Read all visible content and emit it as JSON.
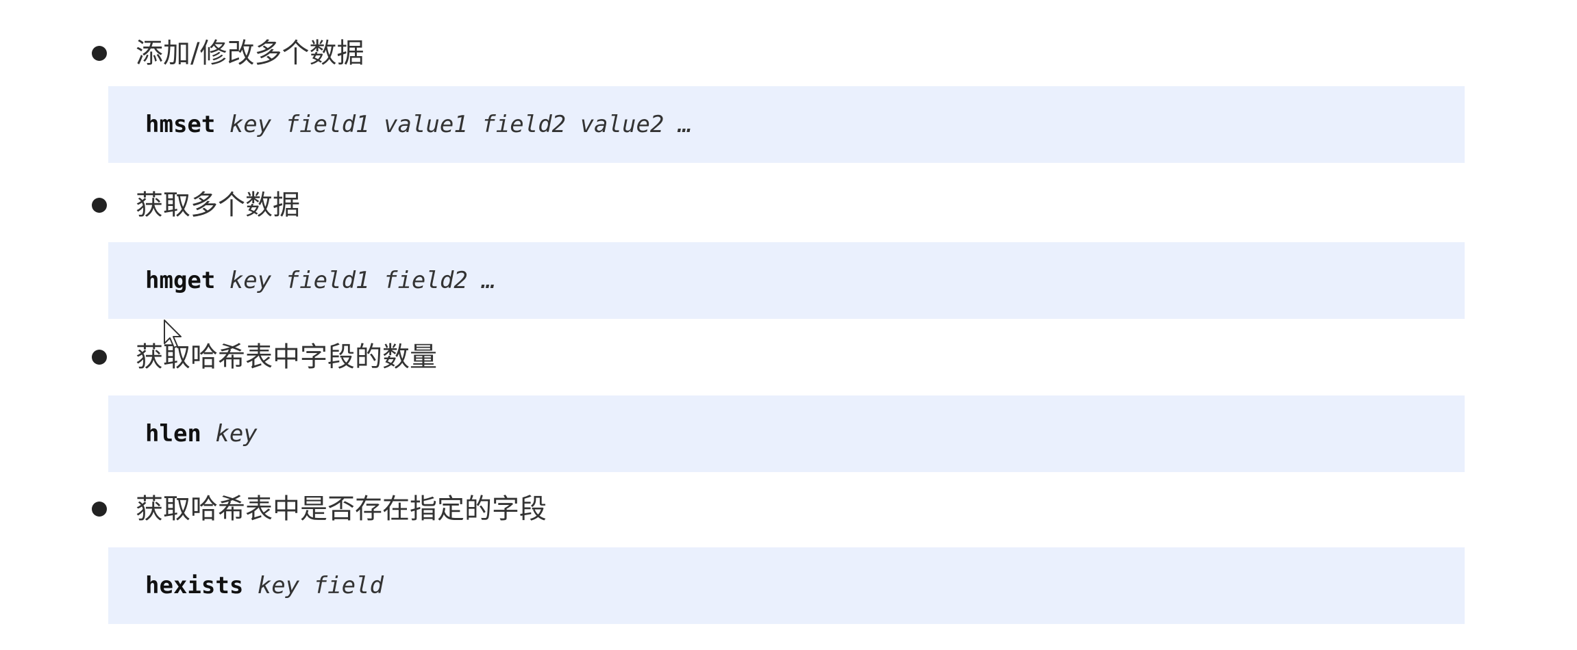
{
  "items": [
    {
      "label": "添加/修改多个数据",
      "command": "hmset",
      "args": " key field1 value1 field2 value2 …"
    },
    {
      "label": "获取多个数据",
      "command": "hmget",
      "args": " key field1 field2 …"
    },
    {
      "label": "获取哈希表中字段的数量",
      "command": "hlen",
      "args": " key"
    },
    {
      "label": "获取哈希表中是否存在指定的字段",
      "command": "hexists",
      "args": " key field"
    }
  ],
  "colors": {
    "code_background": "#eaf0fd",
    "bullet": "#222222",
    "text": "#333333"
  },
  "icons": {
    "bullet": "filled-circle",
    "cursor": "mouse-pointer-icon"
  }
}
